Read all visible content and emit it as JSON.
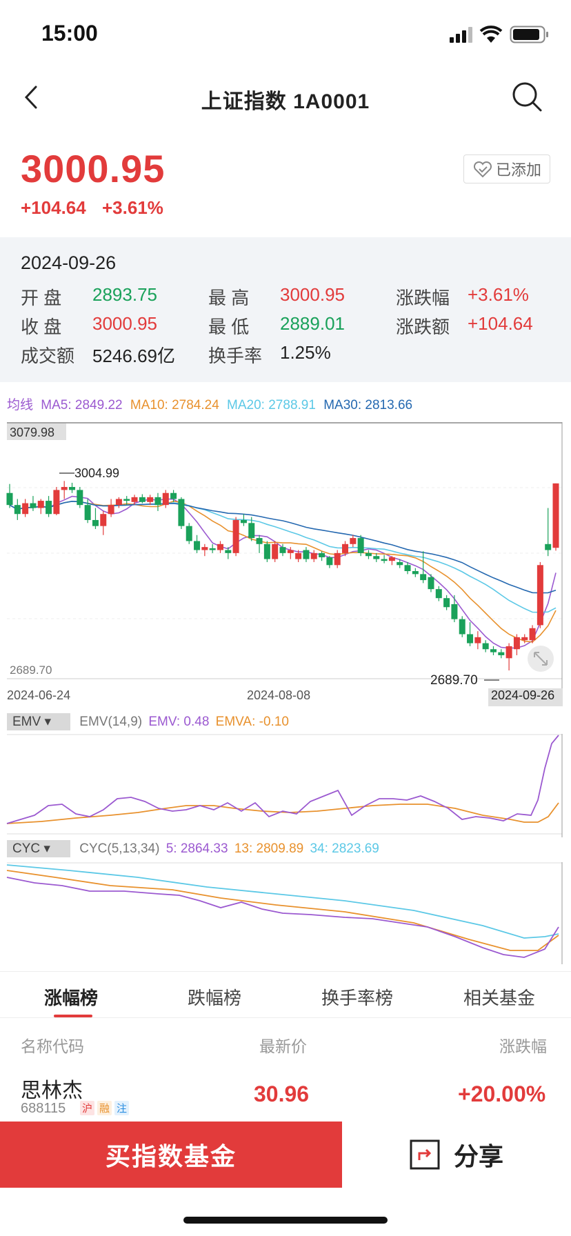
{
  "status_bar": {
    "time": "15:00"
  },
  "nav": {
    "title": "上证指数  1A0001"
  },
  "quote": {
    "price": "3000.95",
    "change_abs": "+104.64",
    "change_pct": "+3.61%",
    "added_label": "已添加"
  },
  "info": {
    "date": "2024-09-26",
    "open_label": "开  盘",
    "open_value": "2893.75",
    "close_label": "收  盘",
    "close_value": "3000.95",
    "amount_label": "成交额",
    "amount_value": "5246.69亿",
    "high_label": "最  高",
    "high_value": "3000.95",
    "low_label": "最  低",
    "low_value": "2889.01",
    "turnover_label": "换手率",
    "turnover_value": "1.25%",
    "pct_label": "涨跌幅",
    "pct_value": "+3.61%",
    "chg_label": "涨跌额",
    "chg_value": "+104.64"
  },
  "ma_legend": {
    "prefix": "均线",
    "ma5": "MA5: 2849.22",
    "ma10": "MA10: 2784.24",
    "ma20": "MA20: 2788.91",
    "ma30": "MA30: 2813.66"
  },
  "main_chart": {
    "top_label": "3079.98",
    "bottom_label": "2689.70",
    "high_mark": "3004.99",
    "low_mark": "2689.70",
    "x_start": "2024-06-24",
    "x_mid": "2024-08-08",
    "x_end": "2024-09-26"
  },
  "emv": {
    "chip": "EMV",
    "params": "EMV(14,9)",
    "emv": "EMV: 0.48",
    "emva": "EMVA: -0.10"
  },
  "cyc": {
    "chip": "CYC",
    "params": "CYC(5,13,34)",
    "c5": "5: 2864.33",
    "c13": "13: 2809.89",
    "c34": "34: 2823.69"
  },
  "tabs": [
    "涨幅榜",
    "跌幅榜",
    "换手率榜",
    "相关基金"
  ],
  "list": {
    "col_name": "名称代码",
    "col_price": "最新价",
    "col_change": "涨跌幅",
    "rows": [
      {
        "name": "思林杰",
        "code": "688115",
        "badges": [
          "沪",
          "融",
          "注"
        ],
        "price": "30.96",
        "change": "+20.00%"
      }
    ]
  },
  "bottom": {
    "buy_label": "买指数基金",
    "share_label": "分享"
  },
  "colors": {
    "up": "#e23b3b",
    "down": "#1aa15a",
    "ma5": "#9b59d0",
    "ma10": "#e8912d",
    "ma20": "#5bc8e6",
    "ma30": "#2468b0"
  },
  "chart_data": {
    "type": "candlestick",
    "title": "上证指数",
    "x": [
      "2024-06-24",
      "2024-08-08",
      "2024-09-26"
    ],
    "ylim": [
      2689.7,
      3079.98
    ],
    "ohlc_approx": [
      {
        "o": 2985,
        "h": 3000,
        "l": 2960,
        "c": 2965
      },
      {
        "o": 2965,
        "h": 2975,
        "l": 2940,
        "c": 2950
      },
      {
        "o": 2950,
        "h": 2975,
        "l": 2945,
        "c": 2968
      },
      {
        "o": 2968,
        "h": 2980,
        "l": 2955,
        "c": 2960
      },
      {
        "o": 2960,
        "h": 2975,
        "l": 2950,
        "c": 2972
      },
      {
        "o": 2972,
        "h": 2980,
        "l": 2945,
        "c": 2950
      },
      {
        "o": 2950,
        "h": 2995,
        "l": 2948,
        "c": 2990
      },
      {
        "o": 2990,
        "h": 3004.99,
        "l": 2975,
        "c": 2995
      },
      {
        "o": 2995,
        "h": 3002,
        "l": 2985,
        "c": 2990
      },
      {
        "o": 2990,
        "h": 2995,
        "l": 2960,
        "c": 2965
      },
      {
        "o": 2965,
        "h": 2975,
        "l": 2935,
        "c": 2940
      },
      {
        "o": 2940,
        "h": 2960,
        "l": 2925,
        "c": 2930
      },
      {
        "o": 2930,
        "h": 2955,
        "l": 2915,
        "c": 2950
      },
      {
        "o": 2950,
        "h": 2975,
        "l": 2945,
        "c": 2965
      },
      {
        "o": 2965,
        "h": 2978,
        "l": 2960,
        "c": 2975
      },
      {
        "o": 2975,
        "h": 2980,
        "l": 2965,
        "c": 2972
      },
      {
        "o": 2970,
        "h": 2982,
        "l": 2965,
        "c": 2978
      },
      {
        "o": 2978,
        "h": 2983,
        "l": 2968,
        "c": 2970
      },
      {
        "o": 2970,
        "h": 2982,
        "l": 2965,
        "c": 2978
      },
      {
        "o": 2978,
        "h": 2985,
        "l": 2955,
        "c": 2965
      },
      {
        "o": 2965,
        "h": 2990,
        "l": 2960,
        "c": 2985
      },
      {
        "o": 2985,
        "h": 2990,
        "l": 2970,
        "c": 2975
      },
      {
        "o": 2975,
        "h": 2978,
        "l": 2925,
        "c": 2930
      },
      {
        "o": 2930,
        "h": 2935,
        "l": 2900,
        "c": 2905
      },
      {
        "o": 2905,
        "h": 2915,
        "l": 2885,
        "c": 2890
      },
      {
        "o": 2890,
        "h": 2900,
        "l": 2880,
        "c": 2895
      },
      {
        "o": 2893,
        "h": 2900,
        "l": 2885,
        "c": 2890
      },
      {
        "o": 2890,
        "h": 2905,
        "l": 2885,
        "c": 2900
      },
      {
        "o": 2890,
        "h": 2895,
        "l": 2875,
        "c": 2885
      },
      {
        "o": 2885,
        "h": 2945,
        "l": 2880,
        "c": 2940
      },
      {
        "o": 2940,
        "h": 2950,
        "l": 2930,
        "c": 2935
      },
      {
        "o": 2935,
        "h": 2945,
        "l": 2905,
        "c": 2910
      },
      {
        "o": 2910,
        "h": 2915,
        "l": 2885,
        "c": 2900
      },
      {
        "o": 2900,
        "h": 2905,
        "l": 2870,
        "c": 2875
      },
      {
        "o": 2875,
        "h": 2905,
        "l": 2870,
        "c": 2900
      },
      {
        "o": 2895,
        "h": 2900,
        "l": 2880,
        "c": 2885
      },
      {
        "o": 2885,
        "h": 2895,
        "l": 2875,
        "c": 2890
      },
      {
        "o": 2875,
        "h": 2890,
        "l": 2870,
        "c": 2885
      },
      {
        "o": 2890,
        "h": 2895,
        "l": 2870,
        "c": 2875
      },
      {
        "o": 2875,
        "h": 2890,
        "l": 2870,
        "c": 2885
      },
      {
        "o": 2885,
        "h": 2888,
        "l": 2872,
        "c": 2878
      },
      {
        "o": 2878,
        "h": 2880,
        "l": 2860,
        "c": 2865
      },
      {
        "o": 2865,
        "h": 2890,
        "l": 2860,
        "c": 2885
      },
      {
        "o": 2885,
        "h": 2905,
        "l": 2880,
        "c": 2900
      },
      {
        "o": 2900,
        "h": 2915,
        "l": 2895,
        "c": 2910
      },
      {
        "o": 2910,
        "h": 2915,
        "l": 2880,
        "c": 2885
      },
      {
        "o": 2885,
        "h": 2890,
        "l": 2875,
        "c": 2880
      },
      {
        "o": 2880,
        "h": 2885,
        "l": 2870,
        "c": 2875
      },
      {
        "o": 2875,
        "h": 2882,
        "l": 2868,
        "c": 2872
      },
      {
        "o": 2872,
        "h": 2880,
        "l": 2865,
        "c": 2878
      },
      {
        "o": 2870,
        "h": 2875,
        "l": 2860,
        "c": 2865
      },
      {
        "o": 2865,
        "h": 2870,
        "l": 2850,
        "c": 2855
      },
      {
        "o": 2855,
        "h": 2860,
        "l": 2845,
        "c": 2850
      },
      {
        "o": 2850,
        "h": 2888,
        "l": 2835,
        "c": 2840
      },
      {
        "o": 2845,
        "h": 2850,
        "l": 2820,
        "c": 2825
      },
      {
        "o": 2825,
        "h": 2830,
        "l": 2805,
        "c": 2810
      },
      {
        "o": 2810,
        "h": 2815,
        "l": 2790,
        "c": 2795
      },
      {
        "o": 2800,
        "h": 2815,
        "l": 2770,
        "c": 2775
      },
      {
        "o": 2775,
        "h": 2780,
        "l": 2745,
        "c": 2750
      },
      {
        "o": 2750,
        "h": 2770,
        "l": 2730,
        "c": 2735
      },
      {
        "o": 2735,
        "h": 2755,
        "l": 2725,
        "c": 2745
      },
      {
        "o": 2735,
        "h": 2740,
        "l": 2720,
        "c": 2725
      },
      {
        "o": 2725,
        "h": 2730,
        "l": 2715,
        "c": 2720
      },
      {
        "o": 2720,
        "h": 2725,
        "l": 2710,
        "c": 2715
      },
      {
        "o": 2710,
        "h": 2735,
        "l": 2689.7,
        "c": 2730
      },
      {
        "o": 2725,
        "h": 2750,
        "l": 2715,
        "c": 2745
      },
      {
        "o": 2740,
        "h": 2750,
        "l": 2735,
        "c": 2745
      },
      {
        "o": 2740,
        "h": 2765,
        "l": 2735,
        "c": 2760
      },
      {
        "o": 2765,
        "h": 2870,
        "l": 2760,
        "c": 2865
      },
      {
        "o": 2900,
        "h": 2960,
        "l": 2880,
        "c": 2890
      },
      {
        "o": 2893.75,
        "h": 3000.95,
        "l": 2889.01,
        "c": 3000.95
      }
    ]
  }
}
